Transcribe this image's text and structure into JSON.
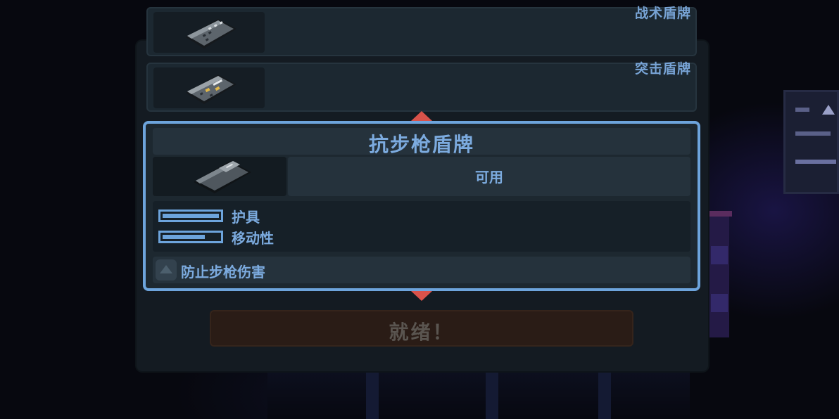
{
  "shield_list": [
    {
      "name": "战术盾牌",
      "icon": "tactical-shield-icon"
    },
    {
      "name": "突击盾牌",
      "icon": "assault-shield-icon"
    }
  ],
  "selected": {
    "title": "抗步枪盾牌",
    "icon": "rifle-shield-icon",
    "status": "可用",
    "stats": [
      {
        "label": "护具",
        "level": 1.0
      },
      {
        "label": "移动性",
        "level": 0.75
      }
    ],
    "perk": {
      "label": "防止步枪伤害",
      "icon": "perk-arrow-icon"
    }
  },
  "ready_button": {
    "label": "就绪！"
  },
  "colors": {
    "accent": "#6da4dc",
    "text": "#7cabdf",
    "arrow": "#d9524a",
    "panel": "#1d2830",
    "ready_disabled": "#2a1c16"
  }
}
